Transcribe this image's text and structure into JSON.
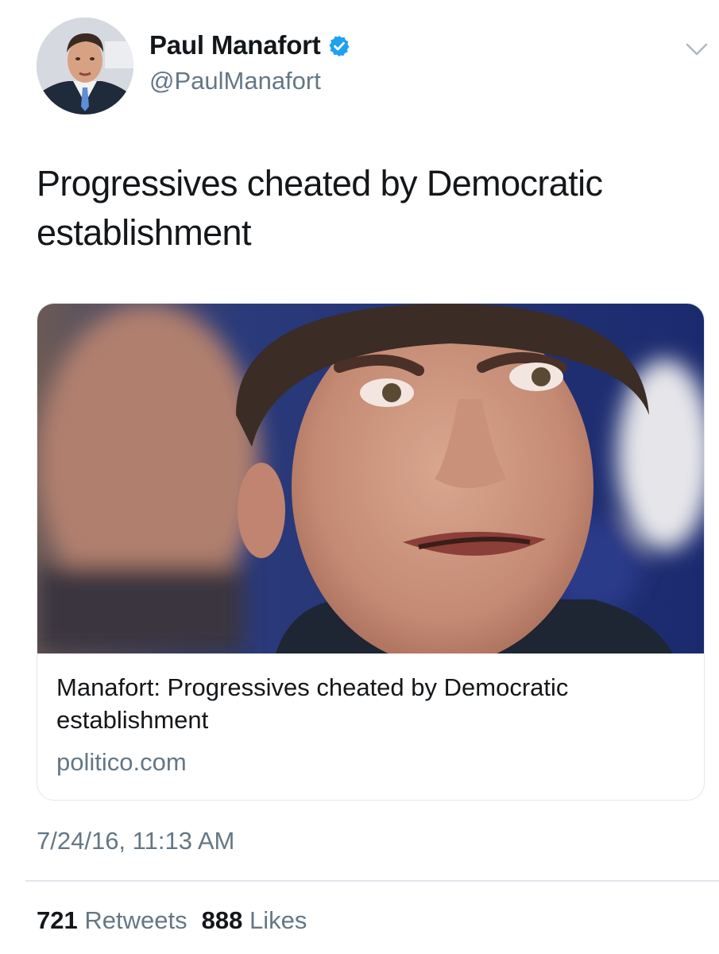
{
  "tweet": {
    "author": {
      "display_name": "Paul Manafort",
      "handle": "@PaulManafort",
      "verified": true
    },
    "text": "Progressives cheated by Democratic establishment",
    "card": {
      "title": "Manafort: Progressives cheated by Democratic establishment",
      "domain": "politico.com"
    },
    "timestamp": "7/24/16, 11:13 AM",
    "stats": {
      "retweets_count": "721",
      "retweets_label": "Retweets",
      "likes_count": "888",
      "likes_label": "Likes"
    }
  },
  "icons": {
    "verified": "verified-badge-icon",
    "menu": "chevron-down-icon"
  },
  "colors": {
    "text_primary": "#14171a",
    "text_secondary": "#657786",
    "verified_blue": "#1da1f2",
    "border": "#e1e8ed"
  }
}
